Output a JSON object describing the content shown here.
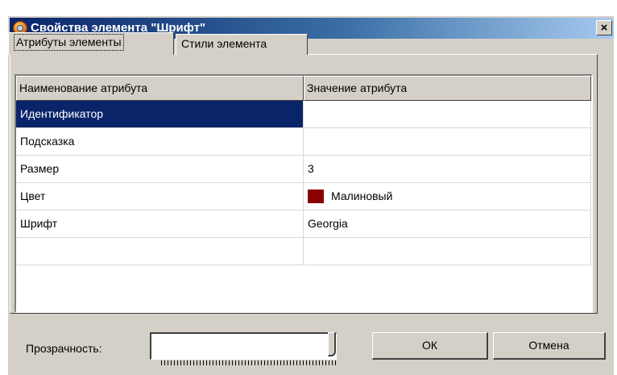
{
  "window": {
    "title": "Свойства элемента \"Шрифт\"",
    "close_glyph": "×"
  },
  "tabs": [
    {
      "label": "Атрибуты элементы",
      "active": true
    },
    {
      "label": "Стили элемента",
      "active": false
    }
  ],
  "grid": {
    "columns": [
      "Наименование атрибута",
      "Значение атрибута"
    ],
    "rows": [
      {
        "name": "Идентификатор",
        "value": "",
        "selected": true
      },
      {
        "name": "Подсказка",
        "value": ""
      },
      {
        "name": "Размер",
        "value": "3"
      },
      {
        "name": "Цвет",
        "value": "Малиновый",
        "color": "#8b0000"
      },
      {
        "name": "Шрифт",
        "value": "Georgia"
      },
      {
        "name": "",
        "value": ""
      }
    ]
  },
  "opacity": {
    "label": "Прозрачность:",
    "value_fraction": 1.0
  },
  "buttons": {
    "ok": "ОК",
    "cancel": "Отмена"
  },
  "colors": {
    "selection": "#0a246a",
    "dialog_face": "#d4d0c8"
  }
}
